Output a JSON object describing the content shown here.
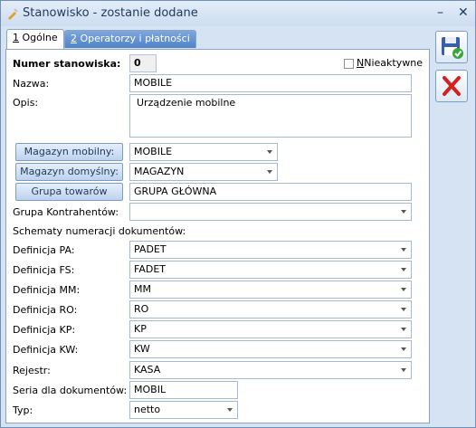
{
  "window": {
    "title": "Stanowisko - zostanie dodane",
    "minimize": "–",
    "close": "✕"
  },
  "tabs": [
    {
      "hotkey": "1",
      "label": " Ogólne"
    },
    {
      "hotkey": "2",
      "label": " Operatorzy i płatności"
    }
  ],
  "form": {
    "numer_label": "Numer stanowiska:",
    "numer_value": "0",
    "nieaktywne_label": "Nieaktywne",
    "nazwa_label": "Nazwa:",
    "nazwa_value": "MOBILE",
    "opis_label": "Opis:",
    "opis_value": "Urządzenie mobilne",
    "magazyn_mobilny_btn": "Magazyn mobilny:",
    "magazyn_mobilny_value": "MOBILE",
    "magazyn_domyslny_btn": "Magazyn domyślny:",
    "magazyn_domyslny_value": "MAGAZYN",
    "grupa_towarow_btn": "Grupa towarów",
    "grupa_towarow_value": "GRUPA GŁÓWNA",
    "grupa_kontrahentow_label": "Grupa Kontrahentów:",
    "grupa_kontrahentow_value": "",
    "schematy_label": "Schematy numeracji dokumentów:",
    "definicja_pa_label": "Definicja PA:",
    "definicja_pa_value": "PADET",
    "definicja_fs_label": "Definicja FS:",
    "definicja_fs_value": "FADET",
    "definicja_mm_label": "Definicja MM:",
    "definicja_mm_value": "MM",
    "definicja_ro_label": "Definicja RO:",
    "definicja_ro_value": "RO",
    "definicja_kp_label": "Definicja KP:",
    "definicja_kp_value": "KP",
    "definicja_kw_label": "Definicja KW:",
    "definicja_kw_value": "KW",
    "rejestr_label": "Rejestr:",
    "rejestr_value": "KASA",
    "seria_label": "Seria dla dokumentów:",
    "seria_value": "MOBIL",
    "typ_label": "Typ:",
    "typ_value": "netto"
  },
  "icons": {
    "save": "save-floppy-icon",
    "cancel": "cancel-x-icon"
  },
  "colors": {
    "accent": "#4f83c8",
    "cancel_red": "#d42020"
  }
}
